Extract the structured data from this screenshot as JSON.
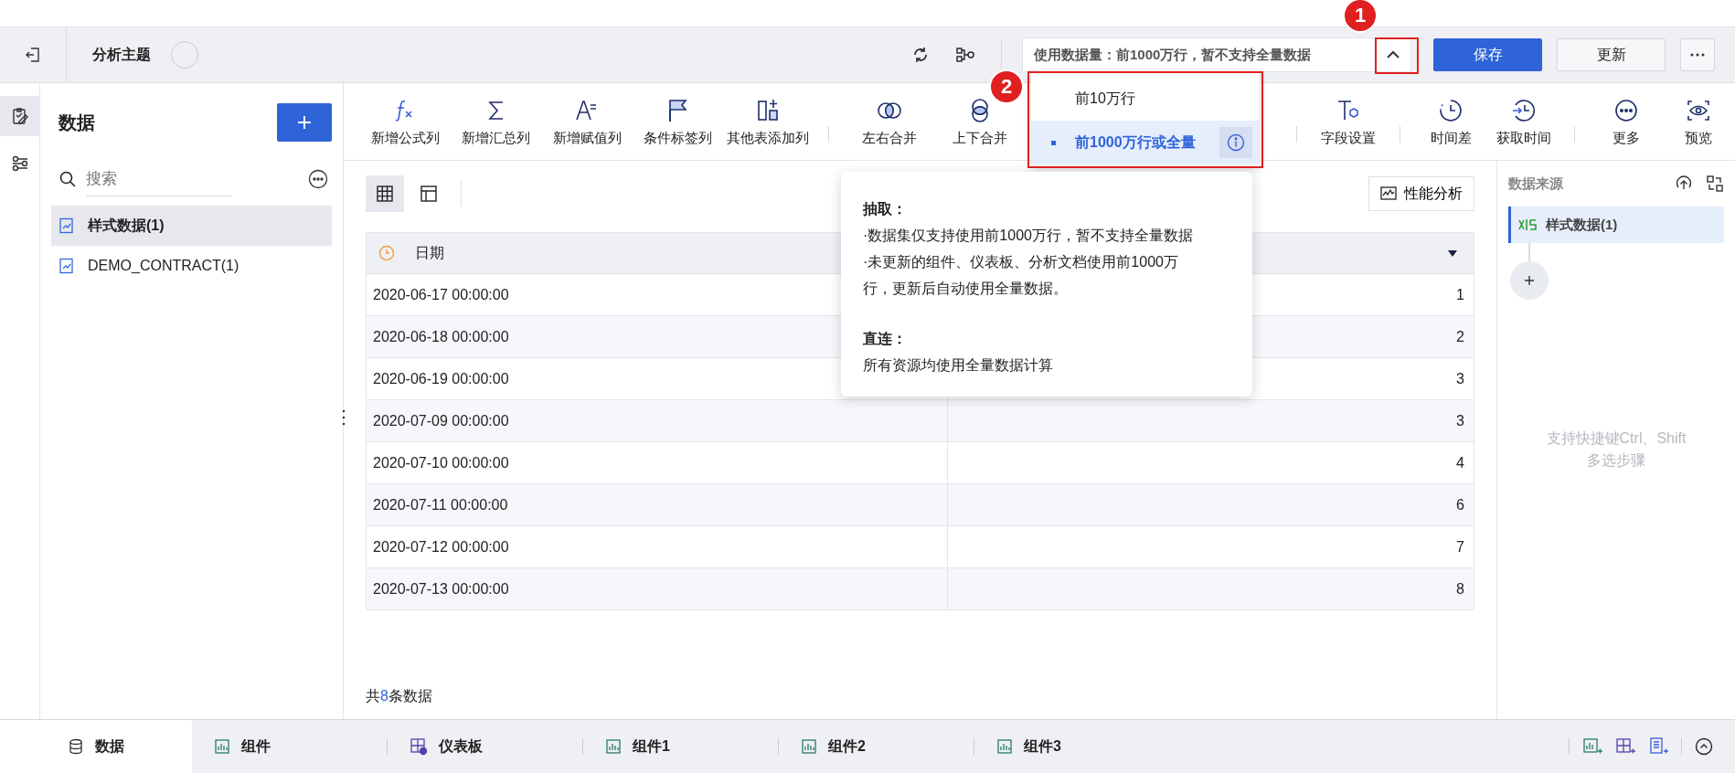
{
  "header": {
    "title": "分析主题",
    "data_volume": "使用数据量：前1000万行，暂不支持全量数据",
    "expanded": true,
    "buttons": [
      {
        "label": "保存",
        "kind": "primary"
      },
      {
        "label": "更新",
        "kind": "default"
      }
    ]
  },
  "rail": [
    {
      "kind": "data",
      "selected": true
    },
    {
      "kind": "filter",
      "selected": false
    }
  ],
  "data_panel": {
    "title": "数据",
    "search": {
      "placeholder": "搜索"
    },
    "items": [
      {
        "label": "样式数据(1)",
        "selected": true
      },
      {
        "label": "DEMO_CONTRACT(1)",
        "selected": false
      }
    ]
  },
  "toolbar": [
    {
      "label": "新增公式列",
      "kind": "formula"
    },
    {
      "label": "新增汇总列",
      "kind": "sum"
    },
    {
      "label": "新增赋值列",
      "kind": "assign"
    },
    {
      "label": "条件标签列",
      "kind": "flag"
    },
    {
      "label": "其他表添加列",
      "kind": "addcol"
    },
    {
      "label": "左右合并",
      "kind": "hmerge"
    },
    {
      "label": "上下合并",
      "kind": "vmerge"
    },
    {
      "label": "字段设置",
      "kind": "field"
    },
    {
      "label": "时间差",
      "kind": "timediff"
    },
    {
      "label": "获取时间",
      "kind": "gettime"
    },
    {
      "label": "更多",
      "kind": "more"
    },
    {
      "label": "预览",
      "kind": "preview"
    }
  ],
  "dropdown": {
    "options": [
      {
        "label": "前10万行",
        "selected": false
      },
      {
        "label": "前1000万行或全量",
        "selected": true
      }
    ]
  },
  "tooltip": {
    "sections": [
      {
        "heading": "抽取：",
        "lines": [
          "·数据集仅支持使用前1000万行，暂不支持全量数据",
          "·未更新的组件、仪表板、分析文档使用前1000万行，更新后自动使用全量数据。"
        ]
      },
      {
        "heading": "直连：",
        "lines": [
          "所有资源均使用全量数据计算"
        ]
      }
    ]
  },
  "view_toggle": [
    {
      "kind": "grid",
      "selected": true
    },
    {
      "kind": "layout",
      "selected": false
    }
  ],
  "perf_button": "性能分析",
  "table": {
    "column_1": "日期",
    "rows": [
      [
        "2020-06-17 00:00:00",
        "1"
      ],
      [
        "2020-06-18 00:00:00",
        "2"
      ],
      [
        "2020-06-19 00:00:00",
        "3"
      ],
      [
        "2020-07-09 00:00:00",
        "3"
      ],
      [
        "2020-07-10 00:00:00",
        "4"
      ],
      [
        "2020-07-11 00:00:00",
        "6"
      ],
      [
        "2020-07-12 00:00:00",
        "7"
      ],
      [
        "2020-07-13 00:00:00",
        "8"
      ]
    ]
  },
  "footer": {
    "prefix": "共",
    "count": "8",
    "suffix": "条数据"
  },
  "right_panel": {
    "title": "数据来源",
    "steps": [
      {
        "label": "样式数据(1)",
        "selected": true
      }
    ],
    "hint": "支持快捷键Ctrl、Shift多选步骤"
  },
  "bottom_tabs": [
    {
      "label": "数据",
      "kind": "data",
      "selected": true
    },
    {
      "label": "组件",
      "kind": "component",
      "selected": false
    },
    {
      "label": "仪表板",
      "kind": "dashboard",
      "selected": false
    },
    {
      "label": "组件1",
      "kind": "component",
      "selected": false
    },
    {
      "label": "组件2",
      "kind": "component",
      "selected": false
    },
    {
      "label": "组件3",
      "kind": "component",
      "selected": false
    }
  ],
  "annotations": [
    {
      "number": "1"
    },
    {
      "number": "2"
    }
  ]
}
